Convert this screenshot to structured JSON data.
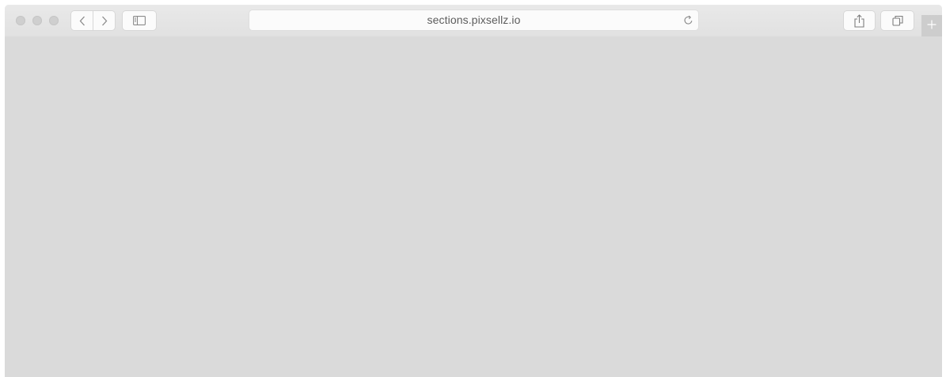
{
  "window": {
    "controls": [
      "close",
      "minimize",
      "zoom"
    ]
  },
  "toolbar": {
    "back_icon": "chevron-left-icon",
    "forward_icon": "chevron-right-icon",
    "sidebar_icon": "sidebar-icon",
    "share_icon": "share-icon",
    "tabs_icon": "tabs-icon",
    "new_tab_icon": "plus-icon"
  },
  "address_bar": {
    "url": "sections.pixsellz.io",
    "reload_icon": "reload-icon"
  },
  "colors": {
    "toolbar_bg": "#e4e4e4",
    "content_bg": "#dadada",
    "control_gray": "#cfcfcf"
  }
}
